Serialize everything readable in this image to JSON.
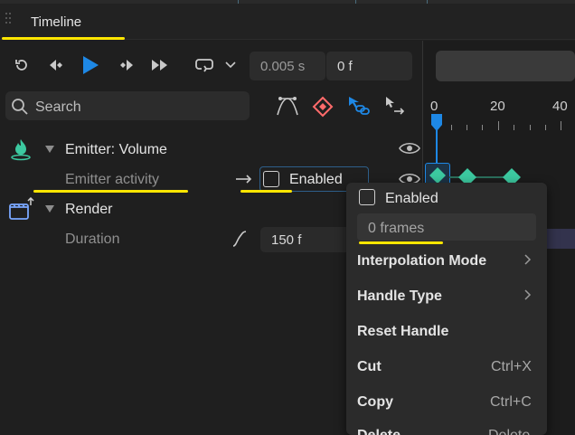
{
  "panel": {
    "title": "Timeline"
  },
  "transport": {
    "time_value": "0.005 s",
    "frame_value": "0 f"
  },
  "search": {
    "placeholder": "Search"
  },
  "ruler": {
    "labels": [
      "0",
      "20",
      "40"
    ]
  },
  "tree": {
    "emitter": {
      "label": "Emitter: Volume"
    },
    "emitter_activity": {
      "label": "Emitter activity",
      "checkbox_label": "Enabled"
    },
    "render": {
      "label": "Render"
    },
    "duration": {
      "label": "Duration",
      "value": "150 f"
    }
  },
  "context_menu": {
    "enabled_label": "Enabled",
    "frames_value": "0 frames",
    "items": [
      {
        "label": "Interpolation Mode",
        "shortcut": "",
        "submenu": true
      },
      {
        "label": "Handle Type",
        "shortcut": "",
        "submenu": true
      },
      {
        "label": "Reset Handle",
        "shortcut": "",
        "submenu": false
      },
      {
        "label": "Cut",
        "shortcut": "Ctrl+X",
        "submenu": false
      },
      {
        "label": "Copy",
        "shortcut": "Ctrl+C",
        "submenu": false
      },
      {
        "label": "Delete",
        "shortcut": "Delete",
        "submenu": false
      }
    ]
  },
  "colors": {
    "accent_blue": "#1e88e5",
    "keyframe_green": "#3cc9a0",
    "annotation_yellow": "#ffe600",
    "diamond_red": "#ff6b6b"
  }
}
